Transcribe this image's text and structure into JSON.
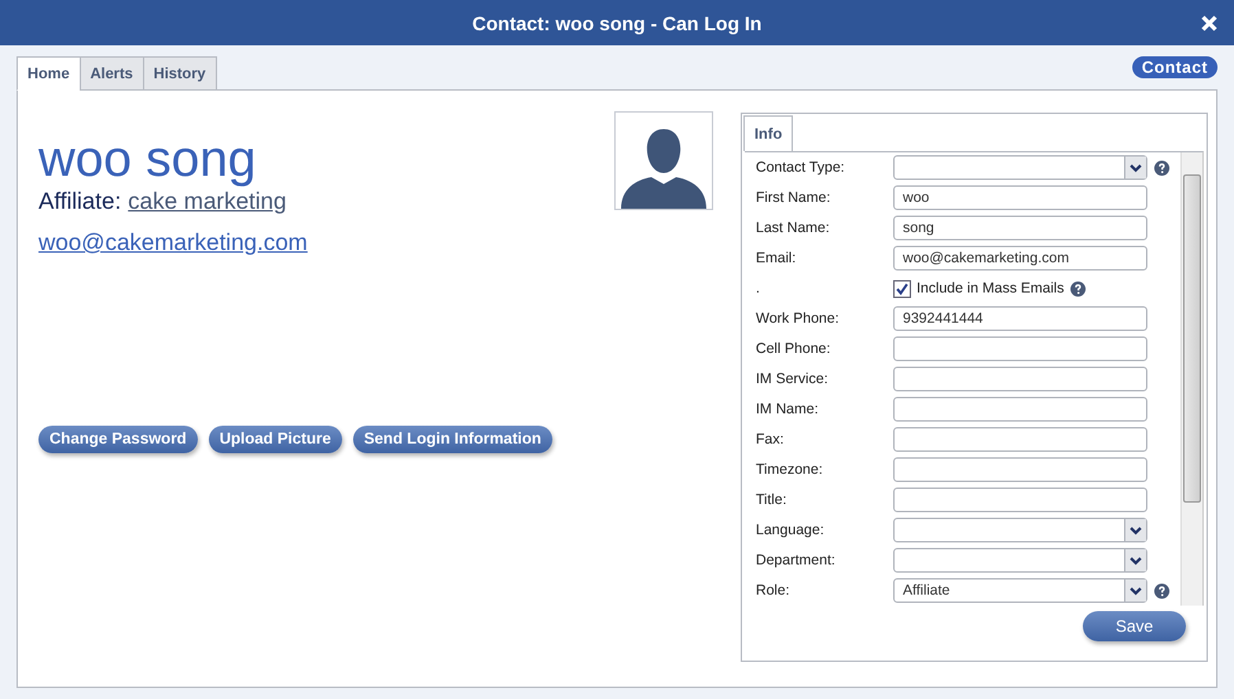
{
  "window": {
    "title": "Contact: woo song - Can Log In"
  },
  "badge": "Contact",
  "tabs": [
    {
      "label": "Home",
      "selected": true
    },
    {
      "label": "Alerts",
      "selected": false
    },
    {
      "label": "History",
      "selected": false
    }
  ],
  "profile": {
    "name": "woo song",
    "affiliate_label": "Affiliate:",
    "affiliate": "cake marketing",
    "email": "woo@cakemarketing.com"
  },
  "actions": [
    "Change Password",
    "Upload Picture",
    "Send Login Information"
  ],
  "info_tab": {
    "label": "Info",
    "selected": true
  },
  "fields": [
    {
      "kind": "select",
      "label": "Contact Type:",
      "help": true
    },
    {
      "kind": "text",
      "label": "First Name:",
      "value": "woo"
    },
    {
      "kind": "text",
      "label": "Last Name:",
      "value": "song"
    },
    {
      "kind": "text",
      "label": "Email:",
      "value": "woo@cakemarketing.com"
    },
    {
      "kind": "checkbox",
      "label": ".",
      "text": "Include in Mass Emails",
      "checked": true,
      "help": true
    },
    {
      "kind": "text",
      "label": "Work Phone:",
      "value": "9392441444"
    },
    {
      "kind": "text",
      "label": "Cell Phone:"
    },
    {
      "kind": "text",
      "label": "IM Service:"
    },
    {
      "kind": "text",
      "label": "IM Name:"
    },
    {
      "kind": "text",
      "label": "Fax:"
    },
    {
      "kind": "text",
      "label": "Timezone:"
    },
    {
      "kind": "text",
      "label": "Title:"
    },
    {
      "kind": "select",
      "label": "Language:"
    },
    {
      "kind": "select",
      "label": "Department:"
    },
    {
      "kind": "select",
      "label": "Role:",
      "value": "Affiliate",
      "help": true
    }
  ],
  "save": "Save"
}
